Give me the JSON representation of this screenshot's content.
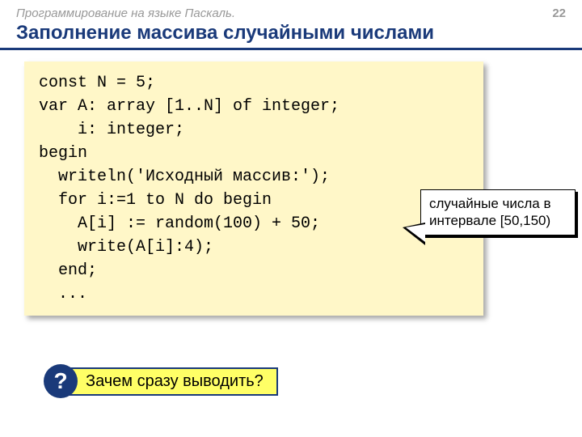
{
  "breadcrumb": "Программирование на языке Паскаль.",
  "page_number": "22",
  "title": "Заполнение массива случайными числами",
  "code": {
    "l1": "const N = 5;",
    "l2": "var A: array [1..N] of integer;",
    "l3": "    i: integer;",
    "l4": "begin",
    "l5": "  writeln('Исходный массив:');",
    "l6": "  for i:=1 to N do begin",
    "l7": "    A[i] := random(100) + 50;",
    "l8": "    write(A[i]:4);",
    "l9": "  end;",
    "l10": "  ..."
  },
  "callout": {
    "line1": "случайные числа в",
    "line2": "интервале [50,150)"
  },
  "question": {
    "badge": "?",
    "text": "Зачем сразу выводить?"
  }
}
